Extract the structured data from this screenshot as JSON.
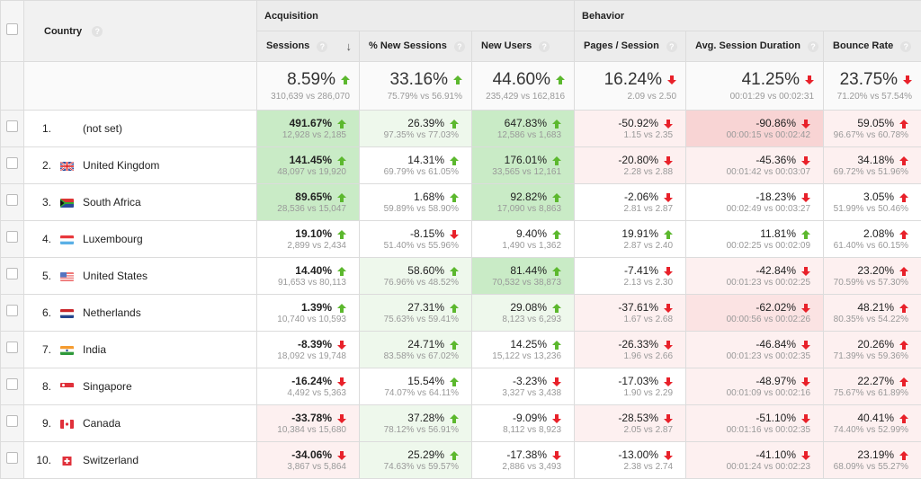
{
  "header": {
    "country_label": "Country",
    "groups": {
      "acquisition": "Acquisition",
      "behavior": "Behavior"
    },
    "columns": [
      "Sessions",
      "% New Sessions",
      "New Users",
      "Pages / Session",
      "Avg. Session Duration",
      "Bounce Rate"
    ],
    "help_glyph": "?",
    "sort_icon": "↓"
  },
  "colors": {
    "up_good": "#5cb82e",
    "down_bad": "#e8212a"
  },
  "totals": [
    {
      "value": "8.59%",
      "compare": "310,639 vs 286,070",
      "trend": "up",
      "tone": "good"
    },
    {
      "value": "33.16%",
      "compare": "75.79% vs 56.91%",
      "trend": "up",
      "tone": "good"
    },
    {
      "value": "44.60%",
      "compare": "235,429 vs 162,816",
      "trend": "up",
      "tone": "good"
    },
    {
      "value": "16.24%",
      "compare": "2.09 vs 2.50",
      "trend": "down",
      "tone": "bad"
    },
    {
      "value": "41.25%",
      "compare": "00:01:29 vs 00:02:31",
      "trend": "down",
      "tone": "bad"
    },
    {
      "value": "23.75%",
      "compare": "71.20% vs 57.54%",
      "trend": "down",
      "tone": "bad"
    }
  ],
  "rows": [
    {
      "index": "1.",
      "country": "(not set)",
      "flag": "none",
      "cells": [
        {
          "value": "491.67%",
          "compare": "12,928 vs 2,185",
          "trend": "up",
          "tone": "good",
          "bg": "g3"
        },
        {
          "value": "26.39%",
          "compare": "97.35% vs 77.03%",
          "trend": "up",
          "tone": "good",
          "bg": "g1"
        },
        {
          "value": "647.83%",
          "compare": "12,586 vs 1,683",
          "trend": "up",
          "tone": "good",
          "bg": "g3"
        },
        {
          "value": "-50.92%",
          "compare": "1.15 vs 2.35",
          "trend": "down",
          "tone": "bad",
          "bg": "r1"
        },
        {
          "value": "-90.86%",
          "compare": "00:00:15 vs 00:02:42",
          "trend": "down",
          "tone": "bad",
          "bg": "r3"
        },
        {
          "value": "59.05%",
          "compare": "96.67% vs 60.78%",
          "trend": "up",
          "tone": "bad",
          "bg": "r1"
        }
      ]
    },
    {
      "index": "2.",
      "country": "United Kingdom",
      "flag": "gb",
      "cells": [
        {
          "value": "141.45%",
          "compare": "48,097 vs 19,920",
          "trend": "up",
          "tone": "good",
          "bg": "g3"
        },
        {
          "value": "14.31%",
          "compare": "69.79% vs 61.05%",
          "trend": "up",
          "tone": "good",
          "bg": "w"
        },
        {
          "value": "176.01%",
          "compare": "33,565 vs 12,161",
          "trend": "up",
          "tone": "good",
          "bg": "g3"
        },
        {
          "value": "-20.80%",
          "compare": "2.28 vs 2.88",
          "trend": "down",
          "tone": "bad",
          "bg": "r1"
        },
        {
          "value": "-45.36%",
          "compare": "00:01:42 vs 00:03:07",
          "trend": "down",
          "tone": "bad",
          "bg": "r1"
        },
        {
          "value": "34.18%",
          "compare": "69.72% vs 51.96%",
          "trend": "up",
          "tone": "bad",
          "bg": "r1"
        }
      ]
    },
    {
      "index": "3.",
      "country": "South Africa",
      "flag": "za",
      "cells": [
        {
          "value": "89.65%",
          "compare": "28,536 vs 15,047",
          "trend": "up",
          "tone": "good",
          "bg": "g3"
        },
        {
          "value": "1.68%",
          "compare": "59.89% vs 58.90%",
          "trend": "up",
          "tone": "good",
          "bg": "w"
        },
        {
          "value": "92.82%",
          "compare": "17,090 vs 8,863",
          "trend": "up",
          "tone": "good",
          "bg": "g3"
        },
        {
          "value": "-2.06%",
          "compare": "2.81 vs 2.87",
          "trend": "down",
          "tone": "bad",
          "bg": "w"
        },
        {
          "value": "-18.23%",
          "compare": "00:02:49 vs 00:03:27",
          "trend": "down",
          "tone": "bad",
          "bg": "w"
        },
        {
          "value": "3.05%",
          "compare": "51.99% vs 50.46%",
          "trend": "up",
          "tone": "bad",
          "bg": "w"
        }
      ]
    },
    {
      "index": "4.",
      "country": "Luxembourg",
      "flag": "lu",
      "cells": [
        {
          "value": "19.10%",
          "compare": "2,899 vs 2,434",
          "trend": "up",
          "tone": "good",
          "bg": "w"
        },
        {
          "value": "-8.15%",
          "compare": "51.40% vs 55.96%",
          "trend": "down",
          "tone": "bad",
          "bg": "w"
        },
        {
          "value": "9.40%",
          "compare": "1,490 vs 1,362",
          "trend": "up",
          "tone": "good",
          "bg": "w"
        },
        {
          "value": "19.91%",
          "compare": "2.87 vs 2.40",
          "trend": "up",
          "tone": "good",
          "bg": "w"
        },
        {
          "value": "11.81%",
          "compare": "00:02:25 vs 00:02:09",
          "trend": "up",
          "tone": "good",
          "bg": "w"
        },
        {
          "value": "2.08%",
          "compare": "61.40% vs 60.15%",
          "trend": "up",
          "tone": "bad",
          "bg": "w"
        }
      ]
    },
    {
      "index": "5.",
      "country": "United States",
      "flag": "us",
      "cells": [
        {
          "value": "14.40%",
          "compare": "91,653 vs 80,113",
          "trend": "up",
          "tone": "good",
          "bg": "w"
        },
        {
          "value": "58.60%",
          "compare": "76.96% vs 48.52%",
          "trend": "up",
          "tone": "good",
          "bg": "g1"
        },
        {
          "value": "81.44%",
          "compare": "70,532 vs 38,873",
          "trend": "up",
          "tone": "good",
          "bg": "g3"
        },
        {
          "value": "-7.41%",
          "compare": "2.13 vs 2.30",
          "trend": "down",
          "tone": "bad",
          "bg": "w"
        },
        {
          "value": "-42.84%",
          "compare": "00:01:23 vs 00:02:25",
          "trend": "down",
          "tone": "bad",
          "bg": "r1"
        },
        {
          "value": "23.20%",
          "compare": "70.59% vs 57.30%",
          "trend": "up",
          "tone": "bad",
          "bg": "r1"
        }
      ]
    },
    {
      "index": "6.",
      "country": "Netherlands",
      "flag": "nl",
      "cells": [
        {
          "value": "1.39%",
          "compare": "10,740 vs 10,593",
          "trend": "up",
          "tone": "good",
          "bg": "w"
        },
        {
          "value": "27.31%",
          "compare": "75.63% vs 59.41%",
          "trend": "up",
          "tone": "good",
          "bg": "g1"
        },
        {
          "value": "29.08%",
          "compare": "8,123 vs 6,293",
          "trend": "up",
          "tone": "good",
          "bg": "g1"
        },
        {
          "value": "-37.61%",
          "compare": "1.67 vs 2.68",
          "trend": "down",
          "tone": "bad",
          "bg": "r1"
        },
        {
          "value": "-62.02%",
          "compare": "00:00:56 vs 00:02:26",
          "trend": "down",
          "tone": "bad",
          "bg": "r2"
        },
        {
          "value": "48.21%",
          "compare": "80.35% vs 54.22%",
          "trend": "up",
          "tone": "bad",
          "bg": "r1"
        }
      ]
    },
    {
      "index": "7.",
      "country": "India",
      "flag": "in",
      "cells": [
        {
          "value": "-8.39%",
          "compare": "18,092 vs 19,748",
          "trend": "down",
          "tone": "bad",
          "bg": "w"
        },
        {
          "value": "24.71%",
          "compare": "83.58% vs 67.02%",
          "trend": "up",
          "tone": "good",
          "bg": "g1"
        },
        {
          "value": "14.25%",
          "compare": "15,122 vs 13,236",
          "trend": "up",
          "tone": "good",
          "bg": "w"
        },
        {
          "value": "-26.33%",
          "compare": "1.96 vs 2.66",
          "trend": "down",
          "tone": "bad",
          "bg": "r1"
        },
        {
          "value": "-46.84%",
          "compare": "00:01:23 vs 00:02:35",
          "trend": "down",
          "tone": "bad",
          "bg": "r1"
        },
        {
          "value": "20.26%",
          "compare": "71.39% vs 59.36%",
          "trend": "up",
          "tone": "bad",
          "bg": "r1"
        }
      ]
    },
    {
      "index": "8.",
      "country": "Singapore",
      "flag": "sg",
      "cells": [
        {
          "value": "-16.24%",
          "compare": "4,492 vs 5,363",
          "trend": "down",
          "tone": "bad",
          "bg": "w"
        },
        {
          "value": "15.54%",
          "compare": "74.07% vs 64.11%",
          "trend": "up",
          "tone": "good",
          "bg": "w"
        },
        {
          "value": "-3.23%",
          "compare": "3,327 vs 3,438",
          "trend": "down",
          "tone": "bad",
          "bg": "w"
        },
        {
          "value": "-17.03%",
          "compare": "1.90 vs 2.29",
          "trend": "down",
          "tone": "bad",
          "bg": "w"
        },
        {
          "value": "-48.97%",
          "compare": "00:01:09 vs 00:02:16",
          "trend": "down",
          "tone": "bad",
          "bg": "r1"
        },
        {
          "value": "22.27%",
          "compare": "75.67% vs 61.89%",
          "trend": "up",
          "tone": "bad",
          "bg": "r1"
        }
      ]
    },
    {
      "index": "9.",
      "country": "Canada",
      "flag": "ca",
      "cells": [
        {
          "value": "-33.78%",
          "compare": "10,384 vs 15,680",
          "trend": "down",
          "tone": "bad",
          "bg": "r1"
        },
        {
          "value": "37.28%",
          "compare": "78.12% vs 56.91%",
          "trend": "up",
          "tone": "good",
          "bg": "g1"
        },
        {
          "value": "-9.09%",
          "compare": "8,112 vs 8,923",
          "trend": "down",
          "tone": "bad",
          "bg": "w"
        },
        {
          "value": "-28.53%",
          "compare": "2.05 vs 2.87",
          "trend": "down",
          "tone": "bad",
          "bg": "r1"
        },
        {
          "value": "-51.10%",
          "compare": "00:01:16 vs 00:02:35",
          "trend": "down",
          "tone": "bad",
          "bg": "r1"
        },
        {
          "value": "40.41%",
          "compare": "74.40% vs 52.99%",
          "trend": "up",
          "tone": "bad",
          "bg": "r1"
        }
      ]
    },
    {
      "index": "10.",
      "country": "Switzerland",
      "flag": "ch",
      "cells": [
        {
          "value": "-34.06%",
          "compare": "3,867 vs 5,864",
          "trend": "down",
          "tone": "bad",
          "bg": "r1"
        },
        {
          "value": "25.29%",
          "compare": "74.63% vs 59.57%",
          "trend": "up",
          "tone": "good",
          "bg": "g1"
        },
        {
          "value": "-17.38%",
          "compare": "2,886 vs 3,493",
          "trend": "down",
          "tone": "bad",
          "bg": "w"
        },
        {
          "value": "-13.00%",
          "compare": "2.38 vs 2.74",
          "trend": "down",
          "tone": "bad",
          "bg": "w"
        },
        {
          "value": "-41.10%",
          "compare": "00:01:24 vs 00:02:23",
          "trend": "down",
          "tone": "bad",
          "bg": "r1"
        },
        {
          "value": "23.19%",
          "compare": "68.09% vs 55.27%",
          "trend": "up",
          "tone": "bad",
          "bg": "r1"
        }
      ]
    }
  ]
}
